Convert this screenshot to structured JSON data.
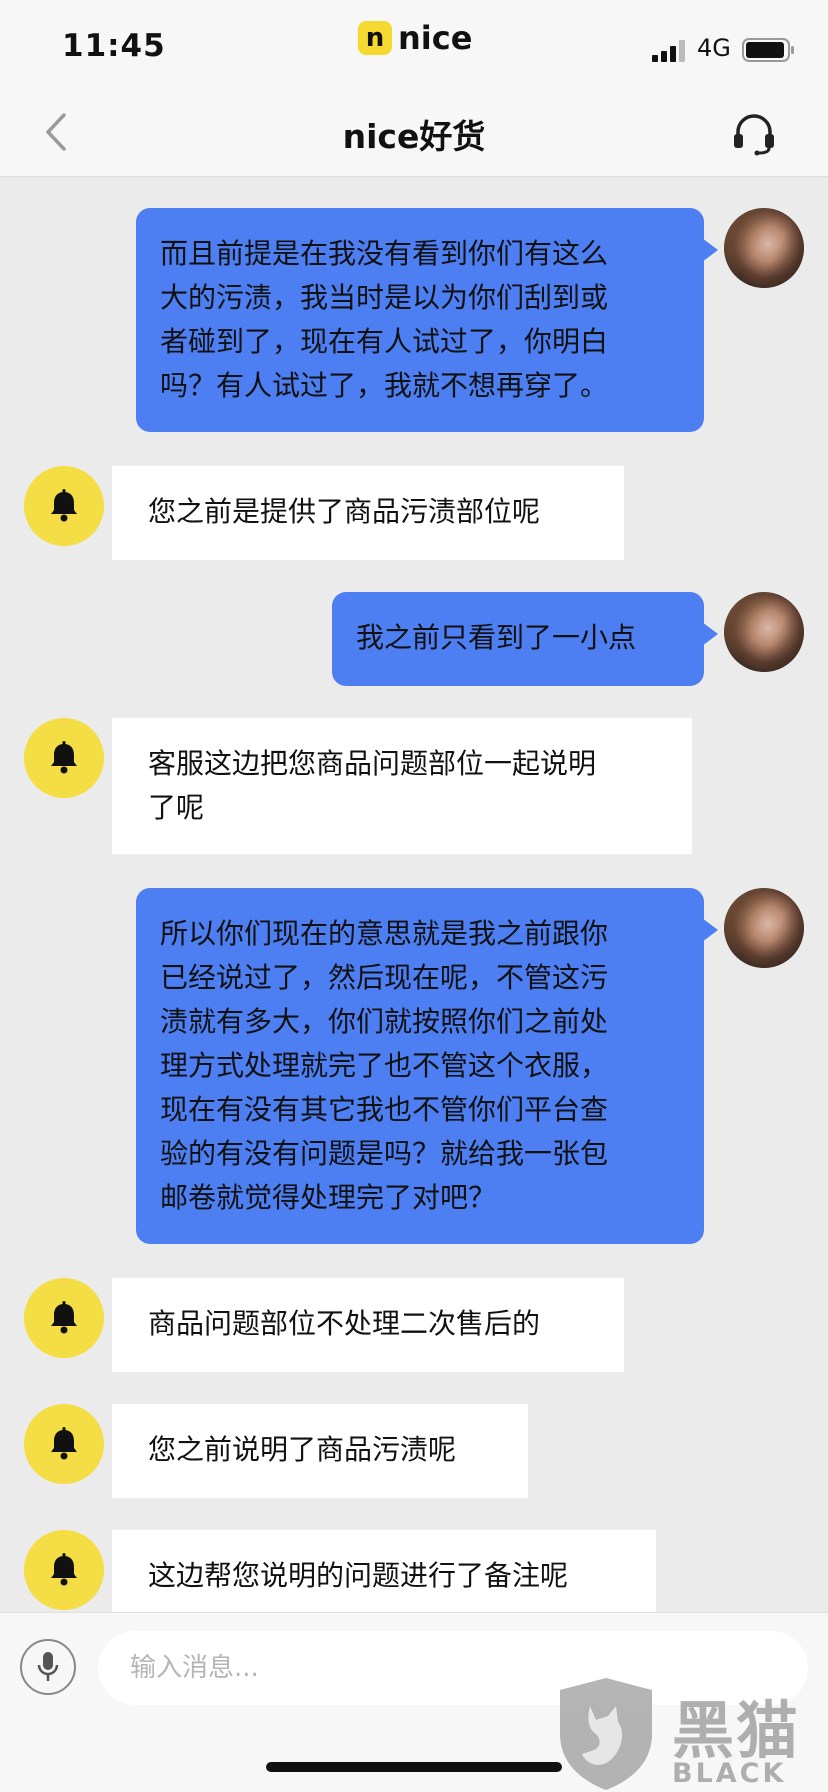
{
  "status_bar": {
    "time": "11:45",
    "app_logo_letter": "n",
    "app_logo_text": "nice",
    "network": "4G"
  },
  "nav": {
    "title": "nice好货",
    "back_icon": "chevron-left-icon",
    "service_icon": "headset-icon"
  },
  "messages": [
    {
      "sender": "user",
      "text": "而且前提是在我没有看到你们有这么\n大的污渍，我当时是以为你们刮到或\n者碰到了，现在有人试过了，你明白\n吗？有人试过了，我就不想再穿了。"
    },
    {
      "sender": "service",
      "text": "您之前是提供了商品污渍部位呢"
    },
    {
      "sender": "user",
      "text": "我之前只看到了一小点"
    },
    {
      "sender": "service",
      "text": "客服这边把您商品问题部位一起说明\n了呢"
    },
    {
      "sender": "user",
      "text": "所以你们现在的意思就是我之前跟你\n已经说过了，然后现在呢，不管这污\n渍就有多大，你们就按照你们之前处\n理方式处理就完了也不管这个衣服，\n现在有没有其它我也不管你们平台查\n验的有没有问题是吗？就给我一张包\n邮卷就觉得处理完了对吧？"
    },
    {
      "sender": "service",
      "text": "商品问题部位不处理二次售后的"
    },
    {
      "sender": "service",
      "text": "您之前说明了商品污渍呢"
    },
    {
      "sender": "service",
      "text": "这边帮您说明的问题进行了备注呢"
    }
  ],
  "input": {
    "placeholder": "输入消息...",
    "value": "",
    "mic_icon": "microphone-icon"
  },
  "watermark": {
    "title": "黑猫",
    "subtitle": "BLACK CAT"
  },
  "colors": {
    "user_bubble": "#4d7ff2",
    "service_bubble": "#ffffff",
    "service_avatar": "#f4dd45",
    "background": "#ebebeb"
  }
}
